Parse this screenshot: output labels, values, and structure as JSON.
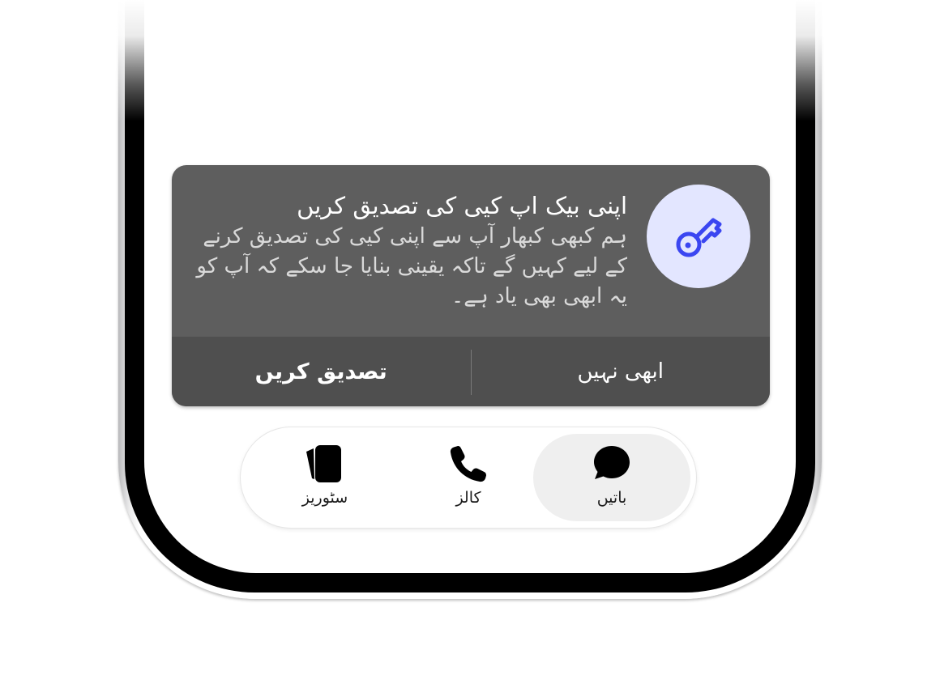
{
  "megaphone": {
    "title": "اپنی بیک اپ کیی کی تصدیق کریں",
    "description": "ہم کبھی کبھار آپ سے اپنی کیی کی تصدیق کرنے کے لیے کہیں گے تاکہ یقینی بنایا جا سکے کہ آپ کو یہ ابھی بھی یاد ہے۔",
    "icon": "key-icon",
    "actions": {
      "confirm_label": "تصدیق کریں",
      "dismiss_label": "ابھی نہیں"
    }
  },
  "tabbar": {
    "tabs": [
      {
        "label": "باتیں",
        "icon": "chat-bubble-icon",
        "selected": true
      },
      {
        "label": "کالز",
        "icon": "phone-icon",
        "selected": false
      },
      {
        "label": "سٹوریز",
        "icon": "stories-icon",
        "selected": false
      }
    ]
  },
  "colors": {
    "card_background": "#5e5e5e",
    "card_actions_background": "#4f4f4f",
    "key_avatar_background": "#e3e6ff",
    "key_accent": "#3b46f1",
    "selected_tab_background": "#efefef"
  }
}
